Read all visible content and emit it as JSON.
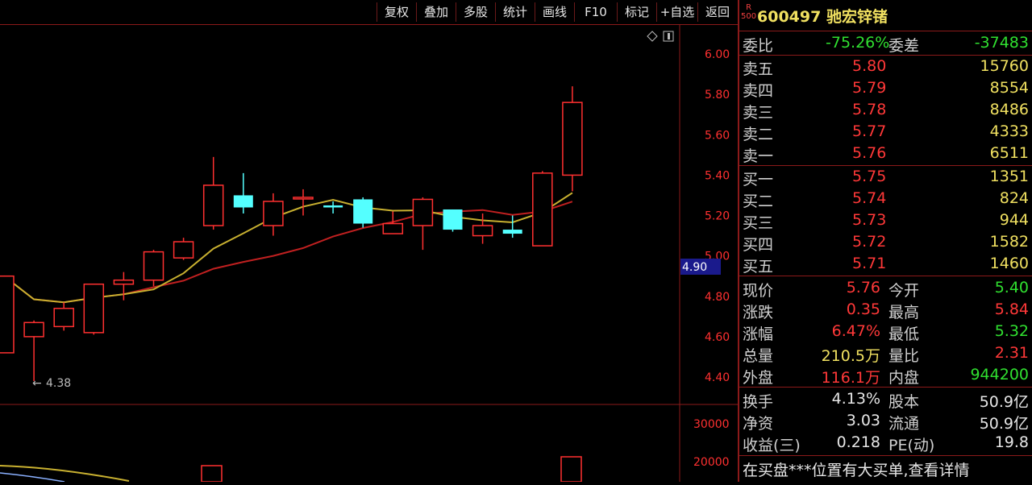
{
  "toolbar": {
    "buttons": [
      "复权",
      "叠加",
      "多股",
      "统计",
      "画线",
      "F10",
      "标记",
      "+自选",
      "返回"
    ]
  },
  "chart": {
    "price_labels": [
      "6.00",
      "5.80",
      "5.60",
      "5.40",
      "5.20",
      "5.00",
      "4.80",
      "4.60",
      "4.40"
    ],
    "current_price_tag": "4.90",
    "low_marker": "4.38",
    "volume_labels": [
      "30000",
      "20000"
    ]
  },
  "chart_data": {
    "type": "candlestick",
    "ylim": [
      4.3,
      6.1
    ],
    "candles": [
      {
        "open": 4.52,
        "close": 4.9,
        "high": 4.9,
        "low": 4.52
      },
      {
        "open": 4.6,
        "close": 4.67,
        "high": 4.68,
        "low": 4.38
      },
      {
        "open": 4.65,
        "close": 4.74,
        "high": 4.77,
        "low": 4.63
      },
      {
        "open": 4.62,
        "close": 4.86,
        "high": 4.86,
        "low": 4.61
      },
      {
        "open": 4.86,
        "close": 4.88,
        "high": 4.92,
        "low": 4.78
      },
      {
        "open": 4.88,
        "close": 5.02,
        "high": 5.03,
        "low": 4.85
      },
      {
        "open": 4.99,
        "close": 5.07,
        "high": 5.09,
        "low": 4.98
      },
      {
        "open": 5.15,
        "close": 5.35,
        "high": 5.49,
        "low": 5.13
      },
      {
        "open": 5.3,
        "close": 5.24,
        "high": 5.41,
        "low": 5.21
      },
      {
        "open": 5.15,
        "close": 5.27,
        "high": 5.31,
        "low": 5.1
      },
      {
        "open": 5.29,
        "close": 5.29,
        "high": 5.33,
        "low": 5.2
      },
      {
        "open": 5.25,
        "close": 5.24,
        "high": 5.27,
        "low": 5.21
      },
      {
        "open": 5.28,
        "close": 5.16,
        "high": 5.29,
        "low": 5.14
      },
      {
        "open": 5.11,
        "close": 5.16,
        "high": 5.22,
        "low": 5.11
      },
      {
        "open": 5.15,
        "close": 5.28,
        "high": 5.29,
        "low": 5.03
      },
      {
        "open": 5.23,
        "close": 5.13,
        "high": 5.23,
        "low": 5.12
      },
      {
        "open": 5.1,
        "close": 5.15,
        "high": 5.21,
        "low": 5.06
      },
      {
        "open": 5.13,
        "close": 5.11,
        "high": 5.2,
        "low": 5.09
      },
      {
        "open": 5.05,
        "close": 5.41,
        "high": 5.42,
        "low": 5.05
      },
      {
        "open": 5.4,
        "close": 5.76,
        "high": 5.84,
        "low": 5.32
      }
    ],
    "colors": {
      "up": "#ff3030",
      "down": "#54ffff",
      "ma_short": "#c8b030",
      "ma_long": "#c02020"
    }
  },
  "quote": {
    "code": "600497",
    "name": "驰宏锌锗",
    "rs_label": [
      "R",
      "500"
    ],
    "wei": {
      "label1": "委比",
      "value1": "-75.26%",
      "label2": "委差",
      "value2": "-37483"
    },
    "sells": [
      {
        "label": "卖五",
        "price": "5.80",
        "vol": "15760"
      },
      {
        "label": "卖四",
        "price": "5.79",
        "vol": "8554"
      },
      {
        "label": "卖三",
        "price": "5.78",
        "vol": "8486"
      },
      {
        "label": "卖二",
        "price": "5.77",
        "vol": "4333"
      },
      {
        "label": "卖一",
        "price": "5.76",
        "vol": "6511"
      }
    ],
    "buys": [
      {
        "label": "买一",
        "price": "5.75",
        "vol": "1351"
      },
      {
        "label": "买二",
        "price": "5.74",
        "vol": "824"
      },
      {
        "label": "买三",
        "price": "5.73",
        "vol": "944"
      },
      {
        "label": "买四",
        "price": "5.72",
        "vol": "1582"
      },
      {
        "label": "买五",
        "price": "5.71",
        "vol": "1460"
      }
    ],
    "stats": [
      {
        "l1": "现价",
        "v1": "5.76",
        "l2": "今开",
        "v2": "5.40"
      },
      {
        "l1": "涨跌",
        "v1": "0.35",
        "l2": "最高",
        "v2": "5.84"
      },
      {
        "l1": "涨幅",
        "v1": "6.47%",
        "l2": "最低",
        "v2": "5.32"
      },
      {
        "l1": "总量",
        "v1": "210.5万",
        "l2": "量比",
        "v2": "2.31"
      },
      {
        "l1": "外盘",
        "v1": "116.1万",
        "l2": "内盘",
        "v2": "944200"
      }
    ],
    "fin": [
      {
        "l1": "换手",
        "v1": "4.13%",
        "l2": "股本",
        "v2": "50.9亿"
      },
      {
        "l1": "净资",
        "v1": "3.03",
        "l2": "流通",
        "v2": "50.9亿"
      },
      {
        "l1": "收益(三)",
        "v1": "0.218",
        "l2": "PE(动)",
        "v2": "19.8"
      }
    ],
    "notice": "在买盘***位置有大买单,查看详情"
  }
}
